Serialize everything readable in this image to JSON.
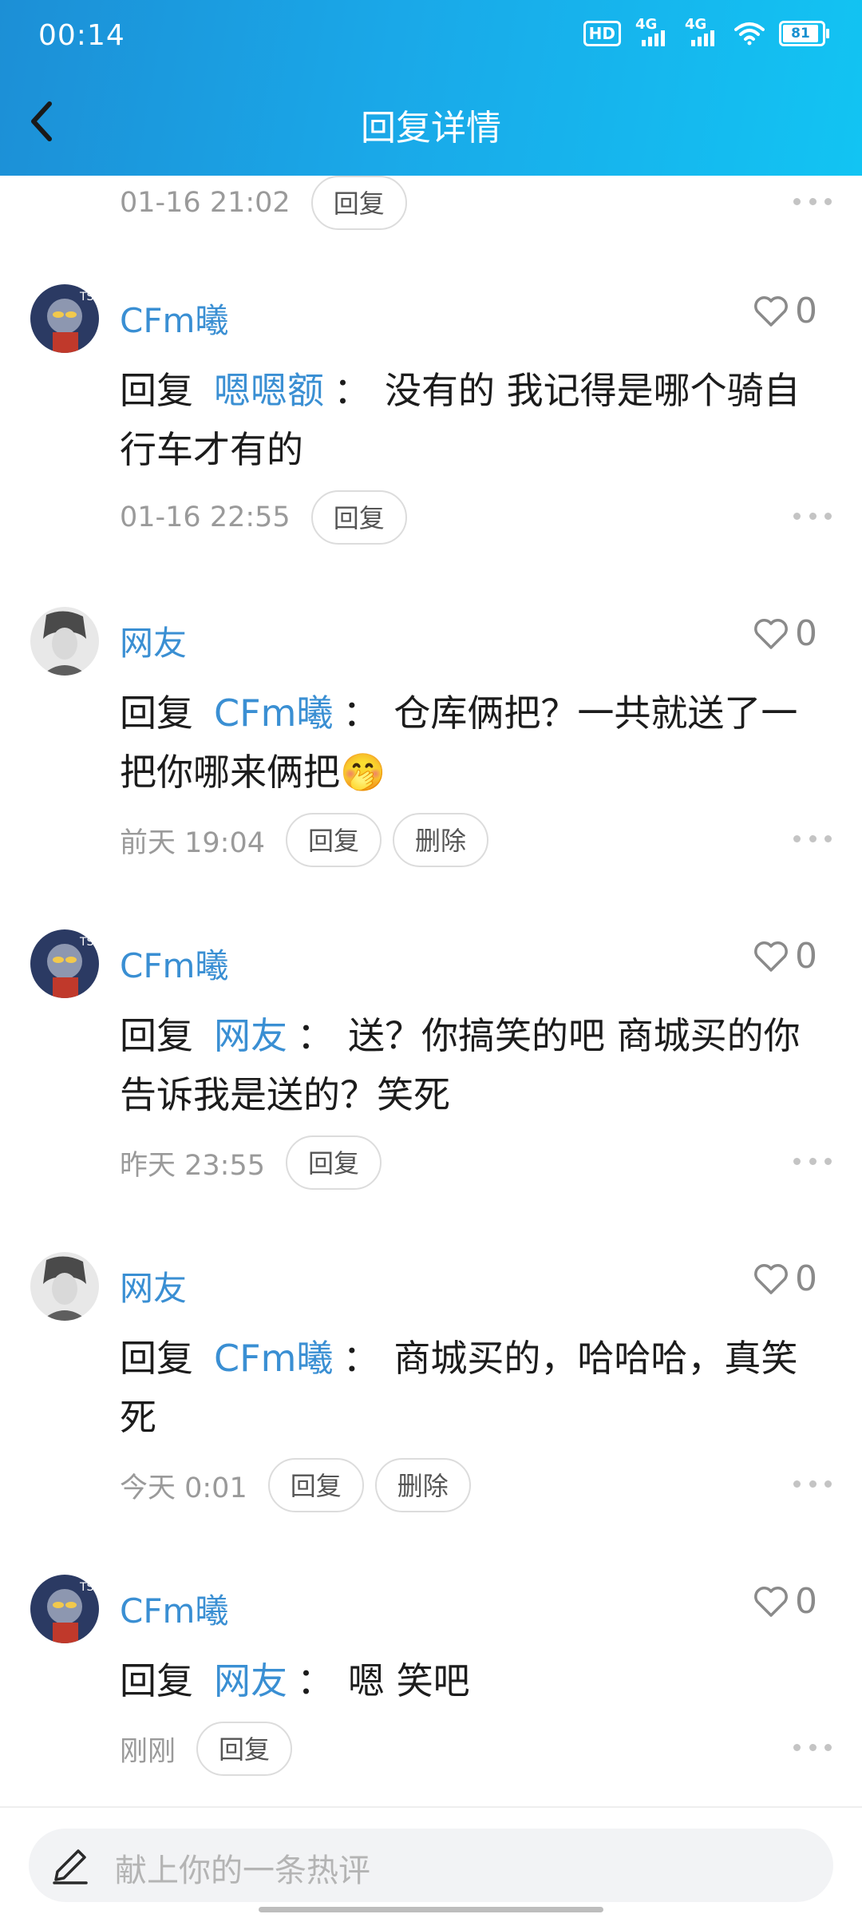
{
  "status_bar": {
    "time": "00:14",
    "network_hd": "HD",
    "signal_1": "4G",
    "signal_2": "4G",
    "battery": "81"
  },
  "header": {
    "title": "回复详情"
  },
  "partial_comment": {
    "time": "01-16 21:02",
    "reply_label": "回复"
  },
  "comments": [
    {
      "user": "CFm曦",
      "likes": "0",
      "reply_prefix": "回复",
      "reply_to": "嗯嗯额",
      "colon": "：",
      "text": "没有的 我记得是哪个骑自行车才有的",
      "time": "01-16 22:55",
      "reply_label": "回复"
    },
    {
      "user": "网友",
      "likes": "0",
      "reply_prefix": "回复",
      "reply_to": "CFm曦",
      "colon": "：",
      "text": "仓库俩把？一共就送了一把你哪来俩把",
      "emoji": "🤭",
      "time": "前天 19:04",
      "reply_label": "回复",
      "delete_label": "删除"
    },
    {
      "user": "CFm曦",
      "likes": "0",
      "reply_prefix": "回复",
      "reply_to": "网友",
      "colon": "：",
      "text": "送？你搞笑的吧 商城买的你告诉我是送的？笑死",
      "time": "昨天 23:55",
      "reply_label": "回复"
    },
    {
      "user": "网友",
      "likes": "0",
      "reply_prefix": "回复",
      "reply_to": "CFm曦",
      "colon": "：",
      "text": "商城买的，哈哈哈，真笑死",
      "time": "今天 0:01",
      "reply_label": "回复",
      "delete_label": "删除"
    },
    {
      "user": "CFm曦",
      "likes": "0",
      "reply_prefix": "回复",
      "reply_to": "网友",
      "colon": "：",
      "text": "嗯 笑吧",
      "time": "刚刚",
      "reply_label": "回复"
    }
  ],
  "composer": {
    "placeholder": "献上你的一条热评"
  },
  "colors": {
    "accent": "#3a8fd3",
    "header_start": "#1c8fd6",
    "header_end": "#12c4f3"
  }
}
